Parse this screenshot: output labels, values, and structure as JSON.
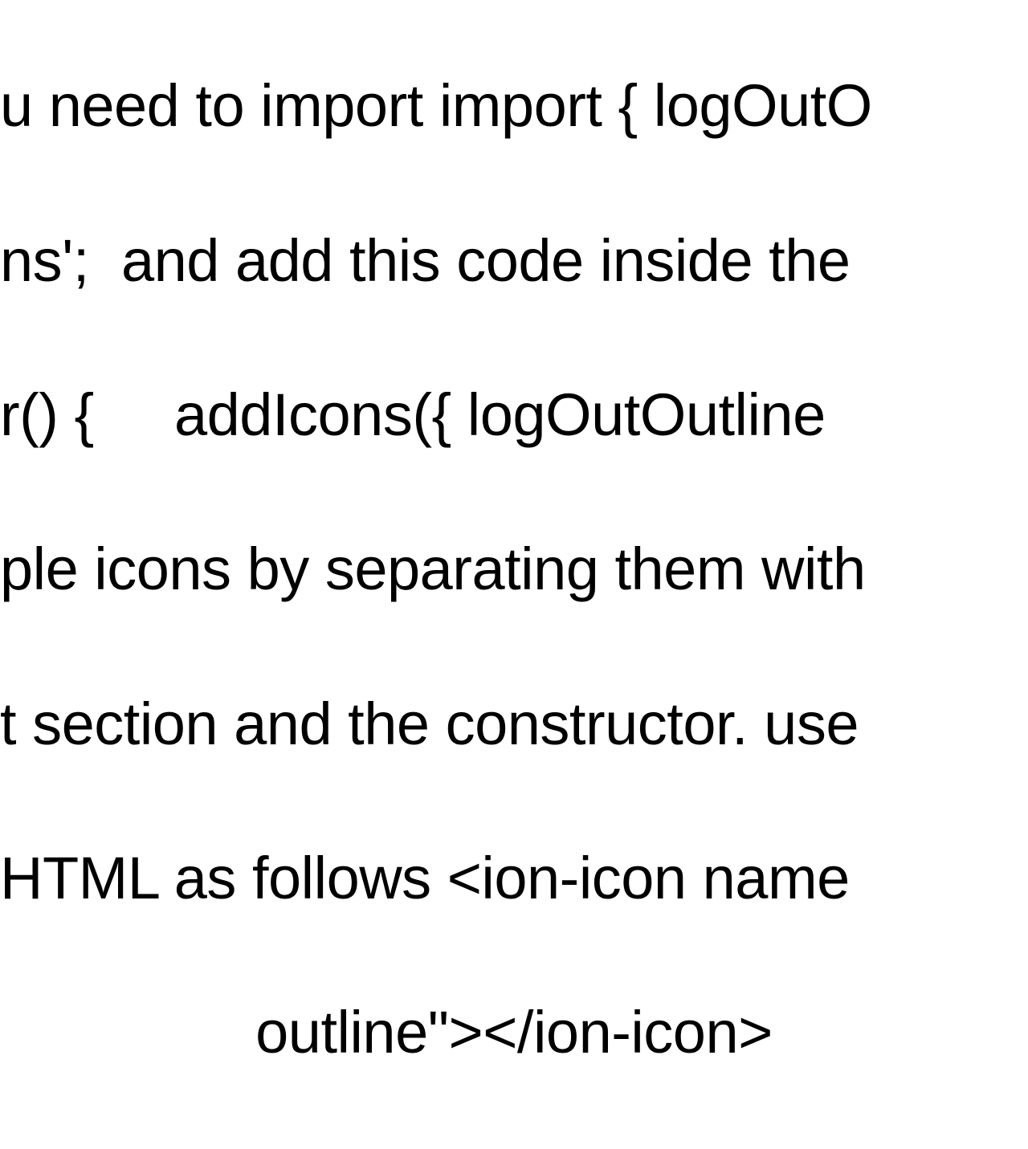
{
  "lines": {
    "l1": "u need to import import { logOutO",
    "l2": "ns';  and add this code inside the",
    "l3": "r() {     addIcons({ logOutOutline ",
    "l4": "ple icons by separating them with",
    "l5": "t section and the constructor. use",
    "l6": "HTML as follows <ion-icon name",
    "l7": "outline\"></ion-icon>"
  }
}
